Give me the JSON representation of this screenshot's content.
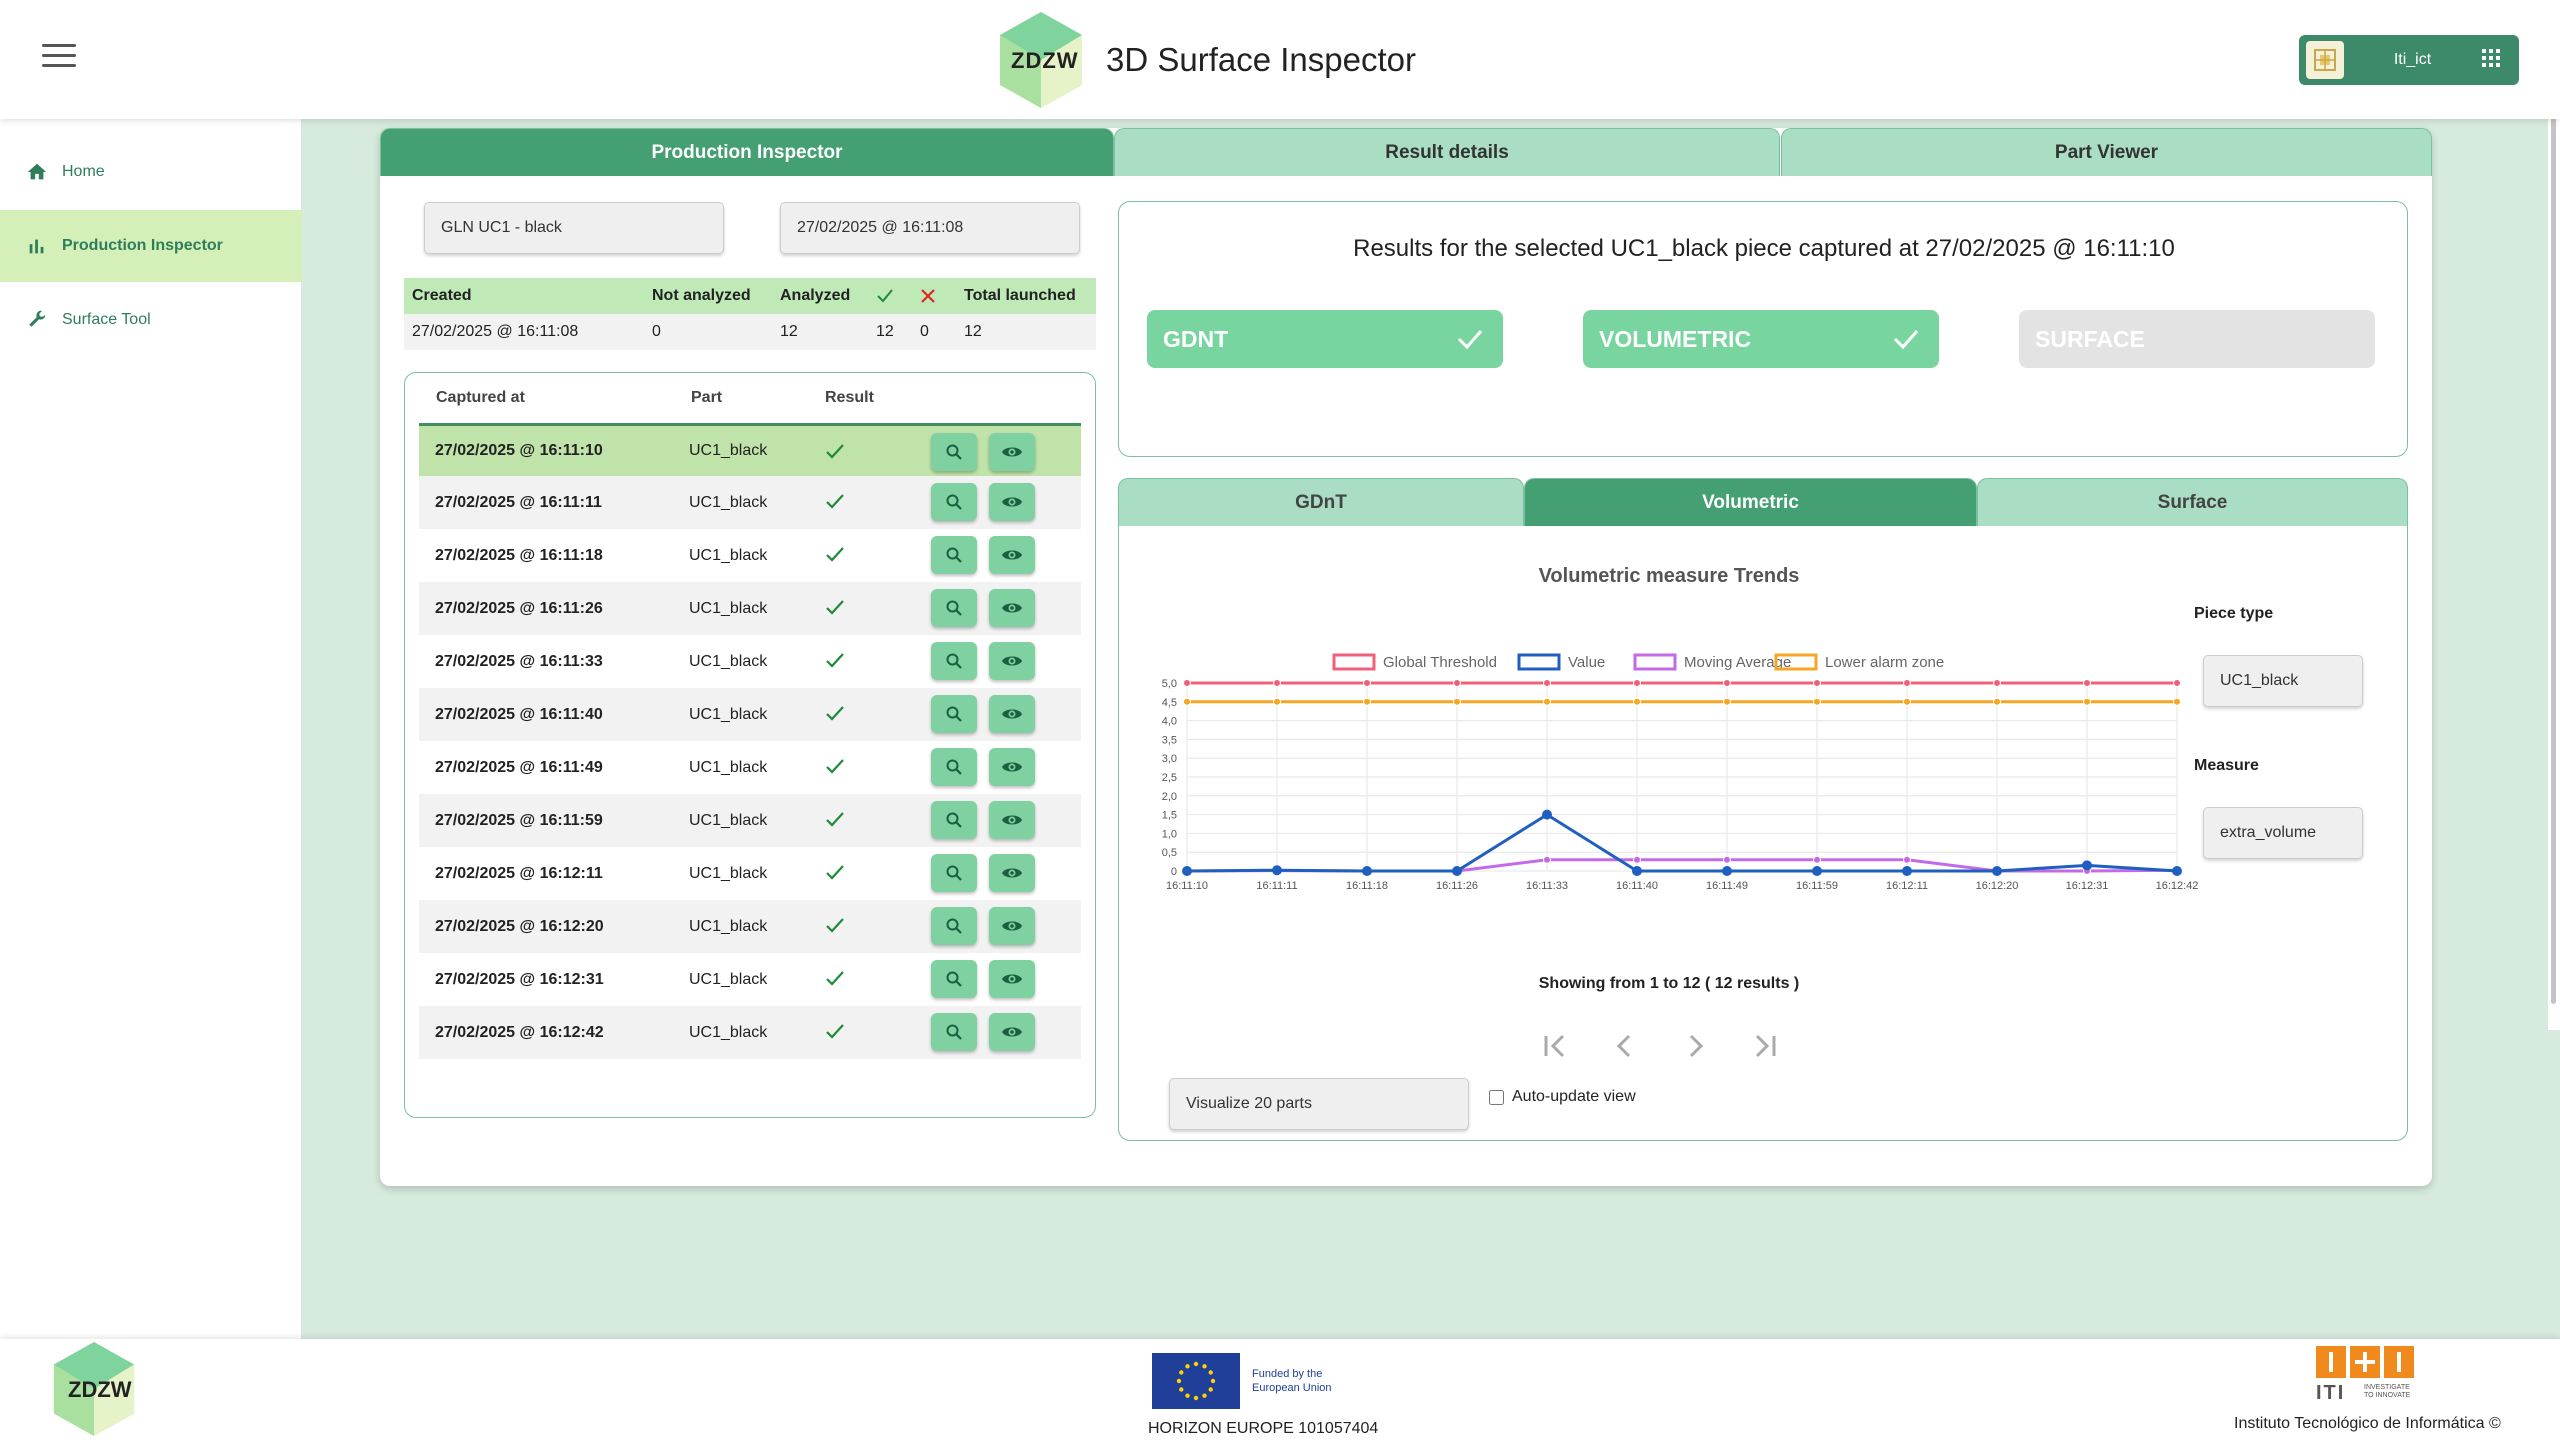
{
  "header": {
    "logo_text": "ZDZW",
    "title": "3D Surface Inspector",
    "user": "Iti_ict"
  },
  "sidebar": {
    "items": [
      {
        "label": "Home",
        "icon": "home-icon"
      },
      {
        "label": "Production Inspector",
        "icon": "bar-chart-icon",
        "active": true
      },
      {
        "label": "Surface Tool",
        "icon": "wrench-icon"
      }
    ]
  },
  "main_tabs": [
    "Production Inspector",
    "Result details",
    "Part Viewer"
  ],
  "filters": {
    "gln": "GLN UC1 - black",
    "datetime": "27/02/2025 @ 16:11:08"
  },
  "summary": {
    "headers": [
      "Created",
      "Not analyzed",
      "Analyzed",
      "Total launched"
    ],
    "values": {
      "created": "27/02/2025 @ 16:11:08",
      "not_analyzed": "0",
      "analyzed": "12",
      "ok": "12",
      "ko": "0",
      "total": "12"
    }
  },
  "list": {
    "headers": [
      "Captured at",
      "Part",
      "Result"
    ],
    "rows": [
      {
        "time": "27/02/2025 @ 16:11:10",
        "part": "UC1_black"
      },
      {
        "time": "27/02/2025 @ 16:11:11",
        "part": "UC1_black"
      },
      {
        "time": "27/02/2025 @ 16:11:18",
        "part": "UC1_black"
      },
      {
        "time": "27/02/2025 @ 16:11:26",
        "part": "UC1_black"
      },
      {
        "time": "27/02/2025 @ 16:11:33",
        "part": "UC1_black"
      },
      {
        "time": "27/02/2025 @ 16:11:40",
        "part": "UC1_black"
      },
      {
        "time": "27/02/2025 @ 16:11:49",
        "part": "UC1_black"
      },
      {
        "time": "27/02/2025 @ 16:11:59",
        "part": "UC1_black"
      },
      {
        "time": "27/02/2025 @ 16:12:11",
        "part": "UC1_black"
      },
      {
        "time": "27/02/2025 @ 16:12:20",
        "part": "UC1_black"
      },
      {
        "time": "27/02/2025 @ 16:12:31",
        "part": "UC1_black"
      },
      {
        "time": "27/02/2025 @ 16:12:42",
        "part": "UC1_black"
      }
    ]
  },
  "results": {
    "title": "Results for the selected UC1_black piece captured at 27/02/2025 @ 16:11:10",
    "pills": [
      {
        "label": "GDNT",
        "status": "ok"
      },
      {
        "label": "VOLUMETRIC",
        "status": "ok"
      },
      {
        "label": "SURFACE",
        "status": "disabled"
      }
    ]
  },
  "sub_tabs": [
    "GDnT",
    "Volumetric",
    "Surface"
  ],
  "controls": {
    "piece_type_label": "Piece type",
    "piece_type": "UC1_black",
    "measure_label": "Measure",
    "measure": "extra_volume",
    "pager_text": "Showing from 1 to 12 ( 12 results )",
    "visualize": "Visualize 20 parts",
    "auto_update": "Auto-update view"
  },
  "chart_data": {
    "type": "line",
    "title": "Volumetric measure Trends",
    "x": [
      "16:11:10",
      "16:11:11",
      "16:11:18",
      "16:11:26",
      "16:11:33",
      "16:11:40",
      "16:11:49",
      "16:11:59",
      "16:12:11",
      "16:12:20",
      "16:12:31",
      "16:12:42"
    ],
    "ylim": [
      0,
      5
    ],
    "yticks": [
      "0",
      "0,5",
      "1,0",
      "1,5",
      "2,0",
      "2,5",
      "3,0",
      "3,5",
      "4,0",
      "4,5",
      "5,0"
    ],
    "grid": true,
    "legend_position": "top",
    "series": [
      {
        "name": "Global Threshold",
        "color": "#f0607a",
        "values": [
          5,
          5,
          5,
          5,
          5,
          5,
          5,
          5,
          5,
          5,
          5,
          5
        ]
      },
      {
        "name": "Value",
        "color": "#1f5fbf",
        "values": [
          0,
          0.02,
          0,
          0,
          1.5,
          0,
          0,
          0,
          0,
          0,
          0.15,
          0
        ]
      },
      {
        "name": "Moving Average",
        "color": "#c46ae6",
        "values": [
          0,
          0.01,
          0,
          0,
          0.3,
          0.3,
          0.3,
          0.3,
          0.3,
          0,
          0,
          0.02
        ]
      },
      {
        "name": "Lower alarm zone",
        "color": "#f5a623",
        "values": [
          4.5,
          4.5,
          4.5,
          4.5,
          4.5,
          4.5,
          4.5,
          4.5,
          4.5,
          4.5,
          4.5,
          4.5
        ]
      }
    ]
  },
  "footer": {
    "logo_text": "ZDZW",
    "eu_text_1": "Funded by the",
    "eu_text_2": "European Union",
    "horizon": "HORIZON EUROPE 101057404",
    "iti_letters": "ITI",
    "iti_tagline_1": "INVESTIGATE",
    "iti_tagline_2": "TO INNOVATE",
    "institute": "Instituto Tecnológico de Informática ©"
  },
  "colors": {
    "primary": "#44a073",
    "tab_inactive": "#a9ddc4",
    "ok_pill": "#79d59f",
    "selected_row": "#bfe3a8",
    "main_bg": "#d6eadd"
  }
}
